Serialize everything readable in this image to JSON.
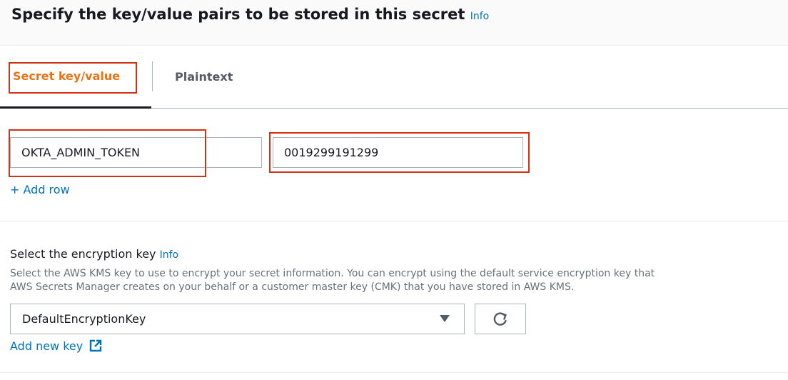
{
  "header": {
    "title": "Specify the key/value pairs to be stored in this secret",
    "info": "Info"
  },
  "tabs": [
    {
      "label": "Secret key/value",
      "active": true
    },
    {
      "label": "Plaintext",
      "active": false
    }
  ],
  "kv": {
    "key_value": "OKTA_ADMIN_TOKEN",
    "secret_value": "0019299191299",
    "add_row": "+ Add row"
  },
  "encryption": {
    "label": "Select the encryption key",
    "info": "Info",
    "description_line1": "Select the AWS KMS key to use to encrypt your secret information. You can encrypt using the default service encryption key that",
    "description_line2": "AWS Secrets Manager creates on your behalf or a customer master key (CMK) that you have stored in AWS KMS.",
    "selected": "DefaultEncryptionKey",
    "add_key": "Add new key"
  },
  "icons": {
    "dropdown": "caret-down-icon",
    "refresh": "refresh-icon",
    "external": "external-link-icon"
  },
  "colors": {
    "accent": "#ec7211",
    "link": "#0073bb",
    "highlight": "#d13212"
  }
}
